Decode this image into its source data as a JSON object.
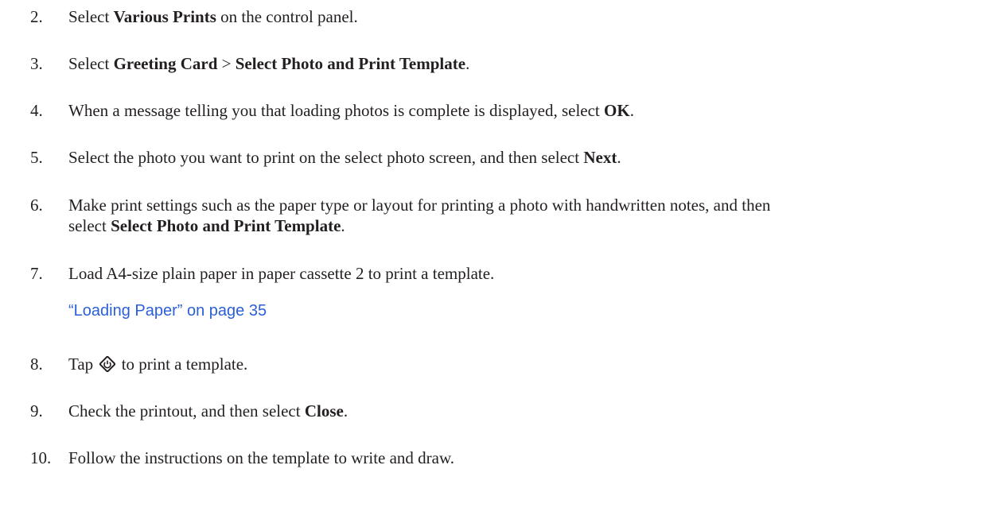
{
  "steps": [
    {
      "num": "2.",
      "parts": [
        {
          "t": "Select ",
          "b": false
        },
        {
          "t": "Various Prints",
          "b": true
        },
        {
          "t": " on the control panel.",
          "b": false
        }
      ]
    },
    {
      "num": "3.",
      "parts": [
        {
          "t": "Select ",
          "b": false
        },
        {
          "t": "Greeting Card",
          "b": true
        },
        {
          "t": " > ",
          "b": false
        },
        {
          "t": "Select Photo and Print Template",
          "b": true
        },
        {
          "t": ".",
          "b": false
        }
      ]
    },
    {
      "num": "4.",
      "parts": [
        {
          "t": "When a message telling you that loading photos is complete is displayed, select ",
          "b": false
        },
        {
          "t": "OK",
          "b": true
        },
        {
          "t": ".",
          "b": false
        }
      ]
    },
    {
      "num": "5.",
      "parts": [
        {
          "t": "Select the photo you want to print on the select photo screen, and then select ",
          "b": false
        },
        {
          "t": "Next",
          "b": true
        },
        {
          "t": ".",
          "b": false
        }
      ]
    },
    {
      "num": "6.",
      "line1": "Make print settings such as the paper type or layout for printing a photo with handwritten notes, and then",
      "line2_prefix": "select ",
      "line2_bold": "Select Photo and Print Template",
      "line2_suffix": "."
    },
    {
      "num": "7.",
      "text": "Load A4-size plain paper in paper cassette 2 to print a template.",
      "link": "“Loading Paper” on page 35"
    },
    {
      "num": "8.",
      "before": "Tap ",
      "icon": "start-button-icon",
      "after": " to print a template."
    },
    {
      "num": "9.",
      "parts": [
        {
          "t": "Check the printout, and then select ",
          "b": false
        },
        {
          "t": "Close",
          "b": true
        },
        {
          "t": ".",
          "b": false
        }
      ]
    },
    {
      "num": "10.",
      "text": "Follow the instructions on the template to write and draw."
    }
  ]
}
